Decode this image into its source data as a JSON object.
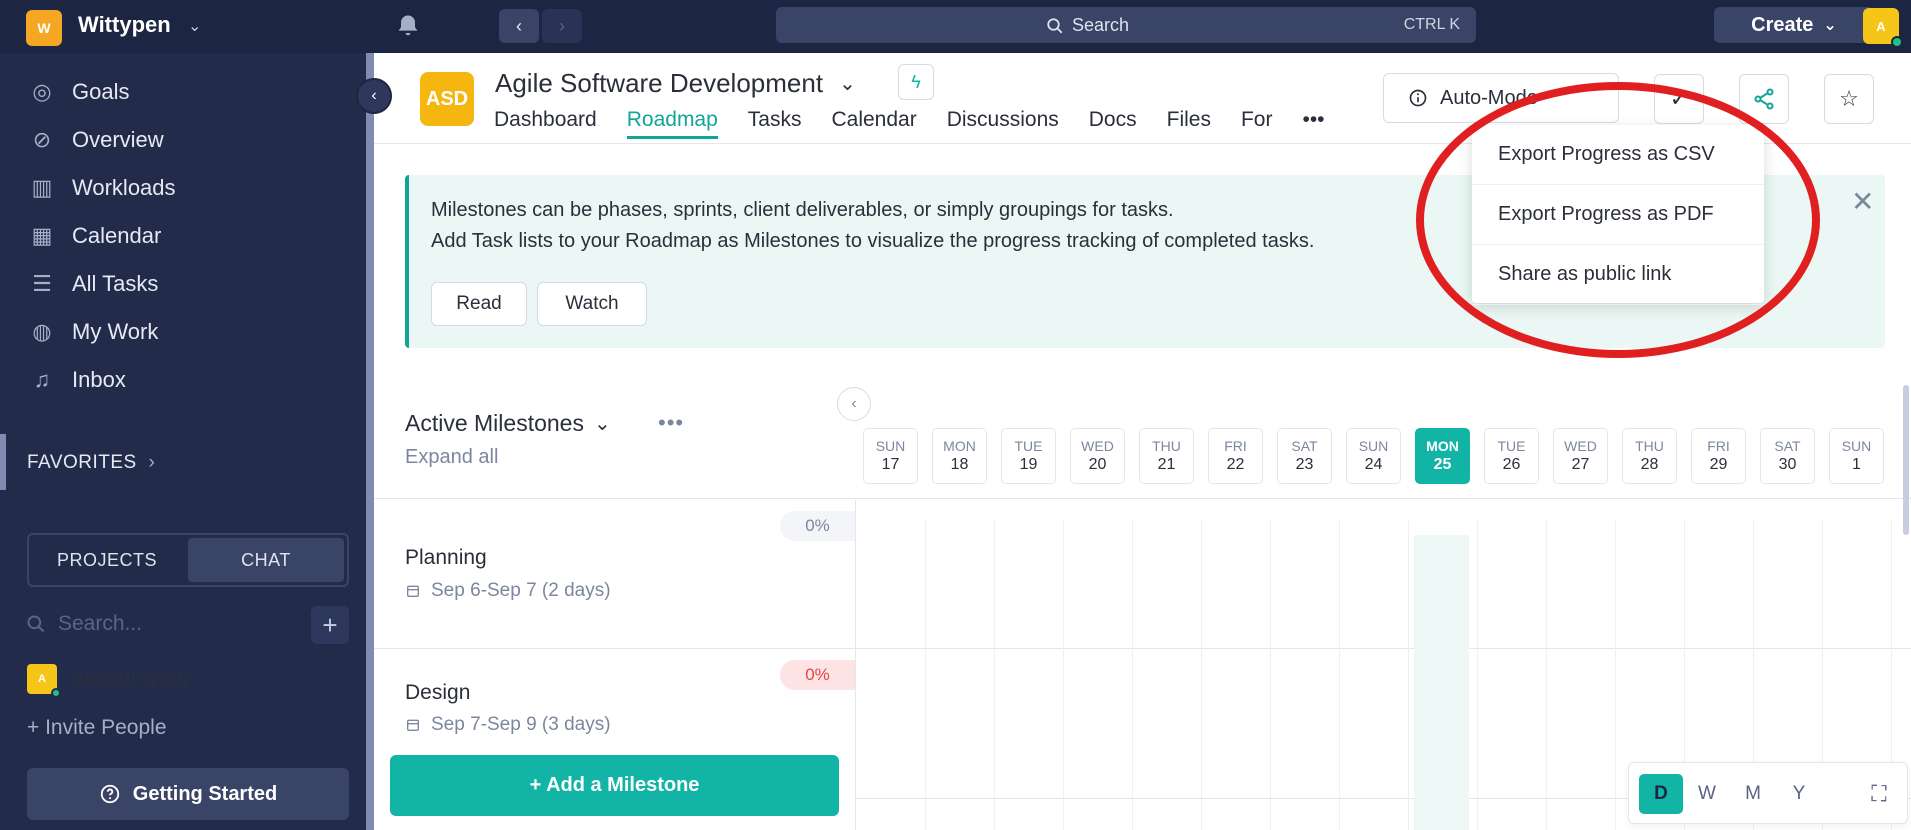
{
  "topbar": {
    "workspace_initial": "W",
    "workspace_name": "Wittypen",
    "search_label": "Search",
    "search_shortcut": "CTRL K",
    "create_label": "Create",
    "user_initial": "A"
  },
  "sidebar": {
    "items": [
      {
        "label": "Goals",
        "icon": "goals-icon"
      },
      {
        "label": "Overview",
        "icon": "compass-icon"
      },
      {
        "label": "Workloads",
        "icon": "bar-chart-icon"
      },
      {
        "label": "Calendar",
        "icon": "calendar-icon"
      },
      {
        "label": "All Tasks",
        "icon": "checklist-icon"
      },
      {
        "label": "My Work",
        "icon": "user-icon"
      },
      {
        "label": "Inbox",
        "icon": "bell-icon"
      }
    ],
    "favorites_label": "FAVORITES",
    "segment": {
      "projects": "PROJECTS",
      "chat": "CHAT"
    },
    "search_placeholder": "Search...",
    "current_user": "Anshul (you)",
    "current_user_initial": "A",
    "invite_label": "+ Invite People",
    "getting_started": "Getting Started"
  },
  "project": {
    "initials": "ASD",
    "title": "Agile Software Development",
    "tabs": [
      "Dashboard",
      "Roadmap",
      "Tasks",
      "Calendar",
      "Discussions",
      "Docs",
      "Files",
      "For"
    ],
    "active_tab": "Roadmap",
    "more_tabs": "•••",
    "automode_label": "Auto-Mode"
  },
  "banner": {
    "line1": "Milestones can be phases, sprints, client deliverables, or simply groupings for tasks.",
    "line2": "Add Task lists to your Roadmap as Milestones to visualize the progress tracking of completed tasks.",
    "read_label": "Read",
    "watch_label": "Watch"
  },
  "dropdown": {
    "items": [
      "Export Progress as CSV",
      "Export Progress as PDF",
      "Share as public link"
    ]
  },
  "milestones": {
    "title": "Active Milestones",
    "more": "•••",
    "expand_all": "Expand all",
    "rows": [
      {
        "name": "Planning",
        "dates": "Sep 6-Sep 7 (2 days)",
        "progress": "0%"
      },
      {
        "name": "Design",
        "dates": "Sep 7-Sep 9 (3 days)",
        "progress": "0%"
      }
    ],
    "add_label": "+ Add a Milestone"
  },
  "timeline": {
    "days": [
      {
        "dow": "SUN",
        "date": "17"
      },
      {
        "dow": "MON",
        "date": "18"
      },
      {
        "dow": "TUE",
        "date": "19"
      },
      {
        "dow": "WED",
        "date": "20"
      },
      {
        "dow": "THU",
        "date": "21"
      },
      {
        "dow": "FRI",
        "date": "22"
      },
      {
        "dow": "SAT",
        "date": "23"
      },
      {
        "dow": "SUN",
        "date": "24"
      },
      {
        "dow": "MON",
        "date": "25"
      },
      {
        "dow": "TUE",
        "date": "26"
      },
      {
        "dow": "WED",
        "date": "27"
      },
      {
        "dow": "THU",
        "date": "28"
      },
      {
        "dow": "FRI",
        "date": "29"
      },
      {
        "dow": "SAT",
        "date": "30"
      },
      {
        "dow": "SUN",
        "date": "1"
      }
    ],
    "today_index": 8,
    "zoom_options": [
      "D",
      "W",
      "M",
      "Y"
    ],
    "zoom_selected": "D"
  },
  "colors": {
    "accent": "#12b5a5",
    "sidebar": "#222b4a",
    "topbar": "#1c2542",
    "annotation": "#e02020"
  }
}
